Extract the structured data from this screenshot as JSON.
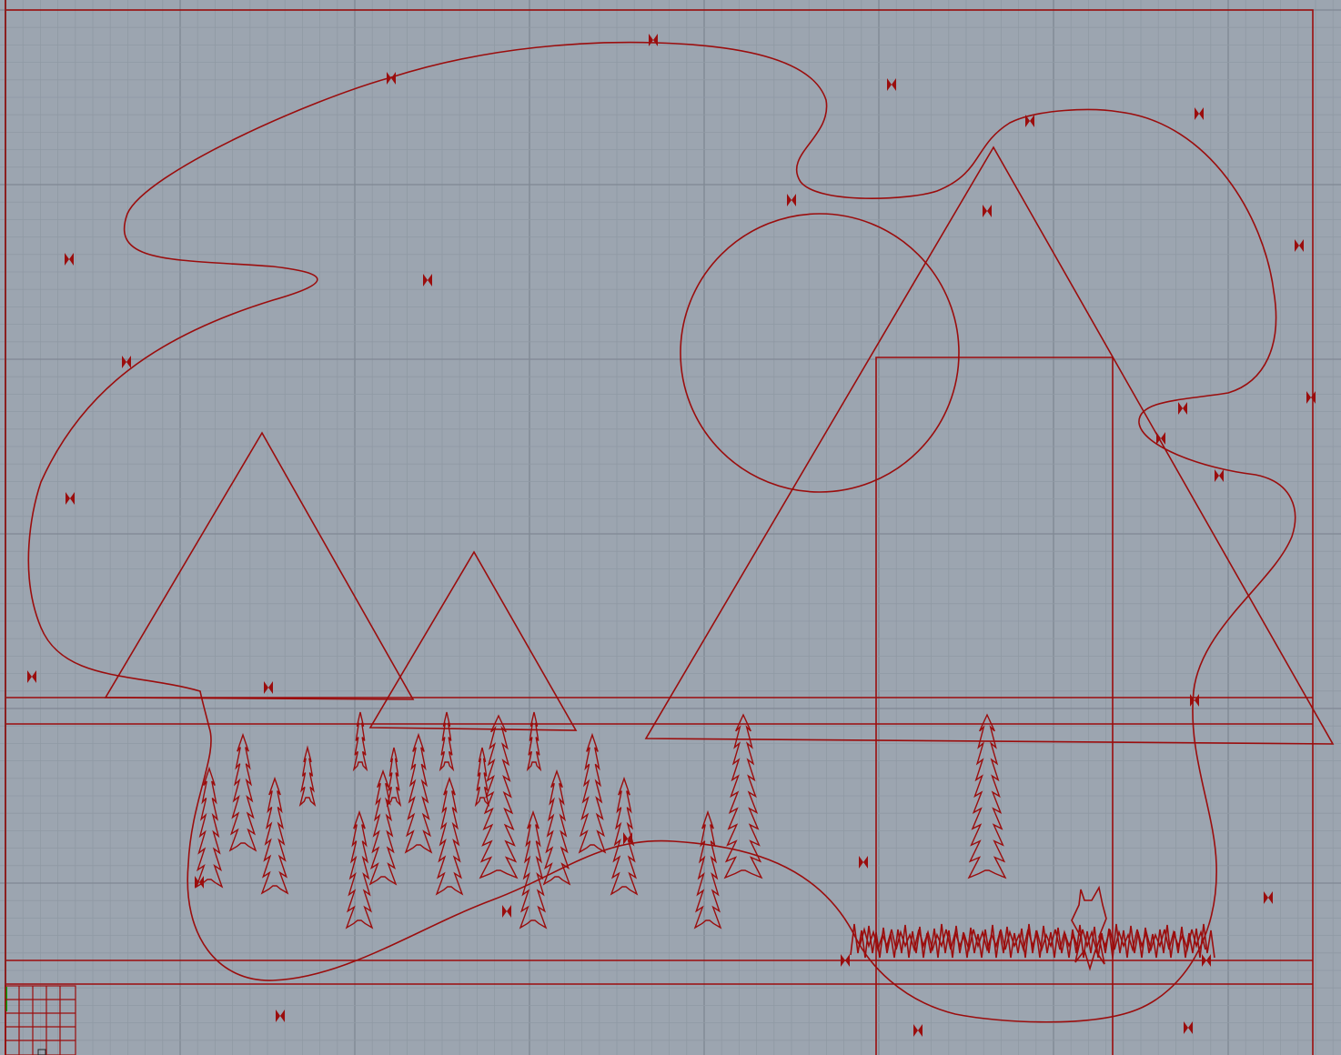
{
  "viewport": {
    "view_name": "",
    "background_color": "#9ca5b0",
    "minor_grid_color": "#8f99a4",
    "major_grid_color": "#7f8893",
    "curve_color": "#9b0d0d",
    "x_axis_color": "#8b0000",
    "y_axis_color": "#00a000"
  },
  "scene": {
    "objects": [
      "sky-outline-curve",
      "sun-circle",
      "large-mountain-triangle",
      "left-mountain-triangle",
      "middle-mountain-triangle",
      "building-rectangle",
      "horizon-lines",
      "pine-trees",
      "ground-curve",
      "grass-strip",
      "fox-figure",
      "point-markers"
    ]
  }
}
